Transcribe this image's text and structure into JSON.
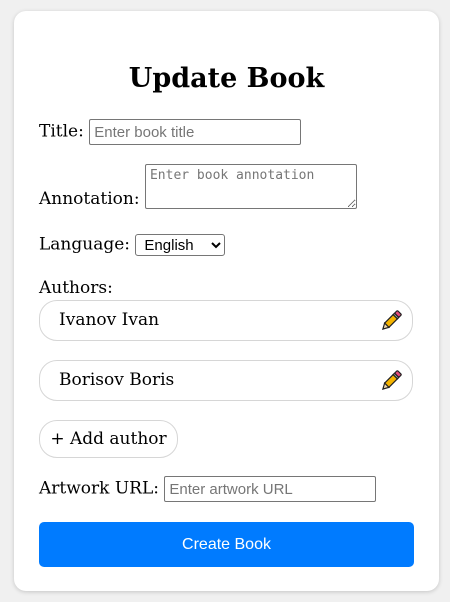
{
  "form": {
    "heading": "Update Book",
    "title_label": "Title:",
    "title_placeholder": "Enter book title",
    "title_value": "",
    "annotation_label": "Annotation:",
    "annotation_placeholder": "Enter book annotation",
    "language_label": "Language:",
    "language_selected": "English",
    "authors_label": "Authors:",
    "authors": [
      {
        "name": "Ivanov Ivan"
      },
      {
        "name": "Borisov Boris"
      }
    ],
    "add_author_label": "+ Add author",
    "artwork_label": "Artwork URL:",
    "artwork_placeholder": "Enter artwork URL",
    "submit_label": "Create Book"
  },
  "colors": {
    "primary": "#007bff",
    "border": "#d6d6d6",
    "pencil_body": "#f5b400",
    "pencil_eraser": "#e84a7a"
  },
  "icons": {
    "edit": "pencil-icon"
  }
}
